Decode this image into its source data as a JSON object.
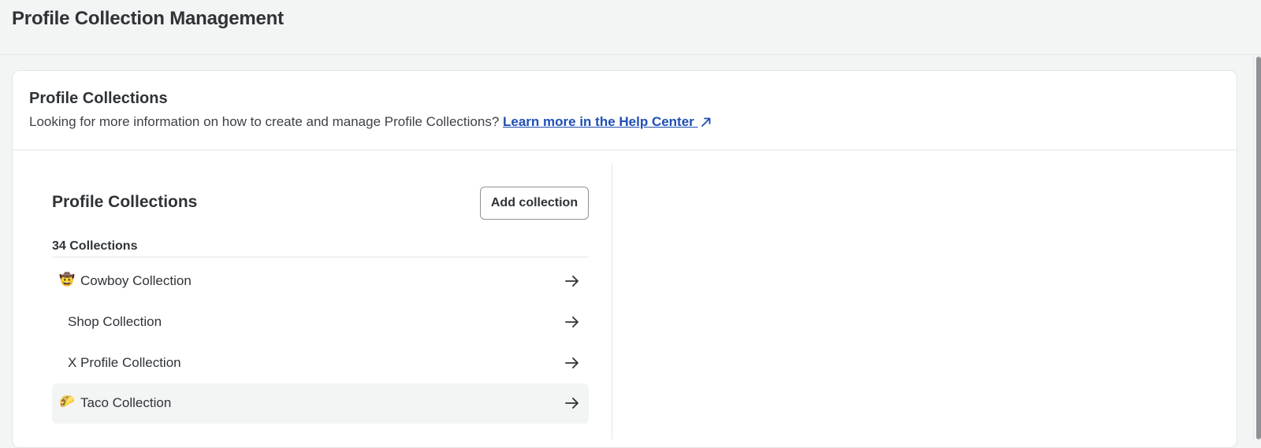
{
  "header": {
    "title": "Profile Collection Management"
  },
  "card": {
    "title": "Profile Collections",
    "description": "Looking for more information on how to create and manage Profile Collections? ",
    "help_link": "Learn more in the Help Center "
  },
  "list": {
    "title": "Profile Collections",
    "add_button": "Add collection",
    "count": "34 Collections",
    "items": [
      {
        "emoji": "🤠",
        "label": "Cowboy Collection",
        "icon": "arrow-right-icon"
      },
      {
        "emoji": "",
        "label": "Shop Collection",
        "icon": "arrow-right-icon"
      },
      {
        "emoji": "",
        "label": "X Profile Collection",
        "icon": "arrow-right-icon"
      },
      {
        "emoji": "🌮",
        "label": "Taco Collection",
        "icon": "arrow-right-icon",
        "highlighted": true
      }
    ]
  },
  "colors": {
    "link": "#1f4fb5",
    "text": "#2f3338",
    "background": "#f3f4f4",
    "row_highlight": "#f3f4f4"
  }
}
